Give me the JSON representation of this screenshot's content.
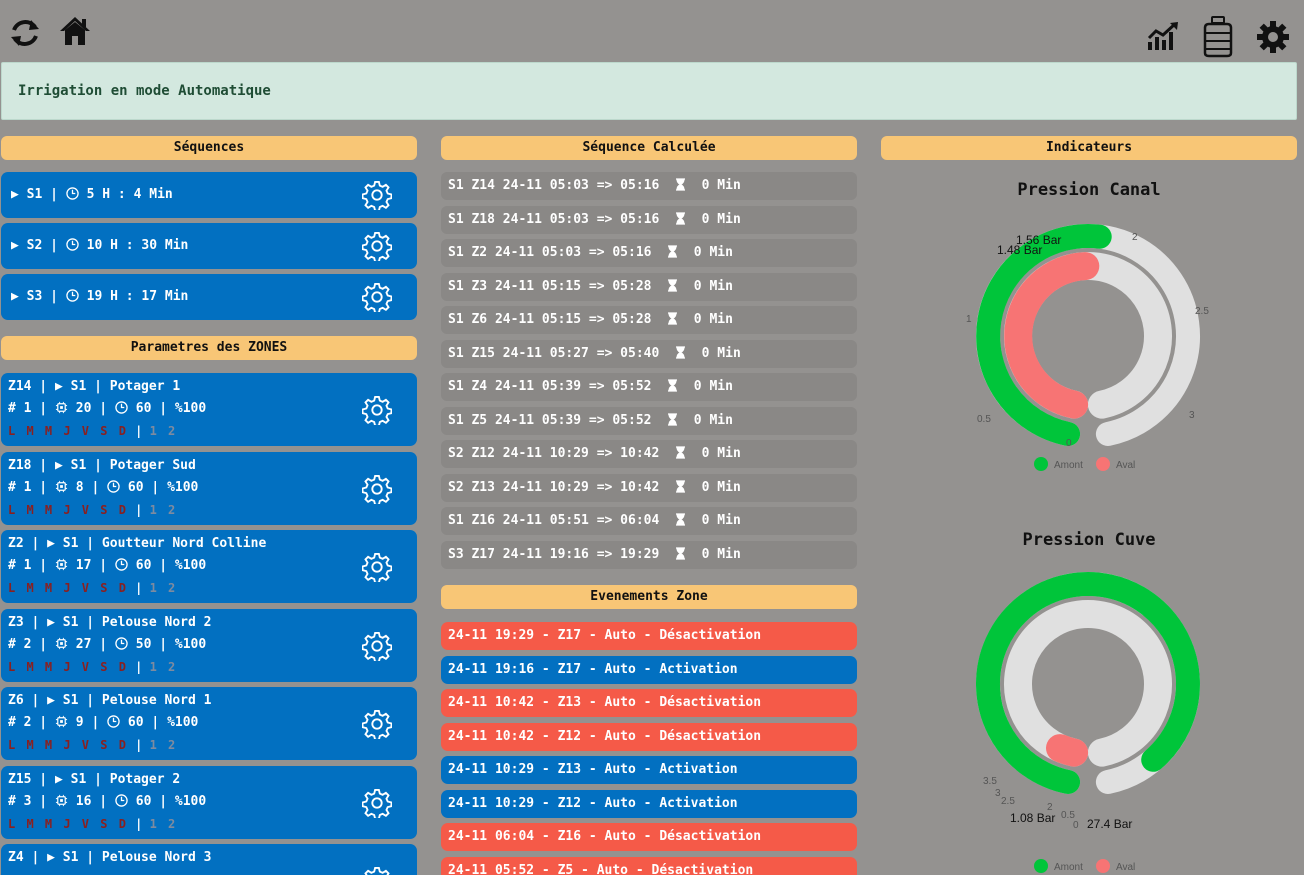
{
  "colors": {
    "blue": "#0270c1",
    "red": "#f55a48",
    "orange": "#f8c676",
    "green": "#00c53a",
    "pink": "#f77474",
    "track": "#e0e0e0"
  },
  "toolbar": {
    "left_icons": [
      "refresh-icon",
      "home-icon"
    ],
    "right_icons": [
      "chart-icon",
      "tank-icon",
      "gear-icon"
    ]
  },
  "banner": {
    "text": "Irrigation en mode Automatique"
  },
  "sequences": {
    "title": "Séquences",
    "items": [
      {
        "id": "S1",
        "duration": "5 H : 4 Min"
      },
      {
        "id": "S2",
        "duration": "10 H : 30 Min"
      },
      {
        "id": "S3",
        "duration": "19 H : 17 Min"
      }
    ]
  },
  "zones": {
    "title": "Parametres des ZONES",
    "days": "L M M J V S D",
    "items": [
      {
        "id": "Z14",
        "seq": "S1",
        "name": "Potager 1",
        "order": "1",
        "flow": "20",
        "time": "60",
        "pct": "100",
        "hours": "1 2"
      },
      {
        "id": "Z18",
        "seq": "S1",
        "name": "Potager Sud",
        "order": "1",
        "flow": "8",
        "time": "60",
        "pct": "100",
        "hours": "1 2"
      },
      {
        "id": "Z2",
        "seq": "S1",
        "name": "Goutteur Nord Colline",
        "order": "1",
        "flow": "17",
        "time": "60",
        "pct": "100",
        "hours": "1 2"
      },
      {
        "id": "Z3",
        "seq": "S1",
        "name": "Pelouse Nord 2",
        "order": "2",
        "flow": "27",
        "time": "50",
        "pct": "100",
        "hours": "1 2"
      },
      {
        "id": "Z6",
        "seq": "S1",
        "name": "Pelouse Nord 1",
        "order": "2",
        "flow": "9",
        "time": "60",
        "pct": "100",
        "hours": "1 2"
      },
      {
        "id": "Z15",
        "seq": "S1",
        "name": "Potager 2",
        "order": "3",
        "flow": "16",
        "time": "60",
        "pct": "100",
        "hours": "1 2"
      },
      {
        "id": "Z4",
        "seq": "S1",
        "name": "Pelouse Nord 3"
      }
    ]
  },
  "calc": {
    "title": "Séquence Calculée",
    "items": [
      {
        "text": "S1 Z14 24-11 05:03 => 05:16",
        "dur": "0 Min"
      },
      {
        "text": "S1 Z18 24-11 05:03 => 05:16",
        "dur": "0 Min"
      },
      {
        "text": "S1 Z2 24-11 05:03 => 05:16",
        "dur": "0 Min"
      },
      {
        "text": "S1 Z3 24-11 05:15 => 05:28",
        "dur": "0 Min"
      },
      {
        "text": "S1 Z6 24-11 05:15 => 05:28",
        "dur": "0 Min"
      },
      {
        "text": "S1 Z15 24-11 05:27 => 05:40",
        "dur": "0 Min"
      },
      {
        "text": "S1 Z4 24-11 05:39 => 05:52",
        "dur": "0 Min"
      },
      {
        "text": "S1 Z5 24-11 05:39 => 05:52",
        "dur": "0 Min"
      },
      {
        "text": "S2 Z12 24-11 10:29 => 10:42",
        "dur": "0 Min"
      },
      {
        "text": "S2 Z13 24-11 10:29 => 10:42",
        "dur": "0 Min"
      },
      {
        "text": "S1 Z16 24-11 05:51 => 06:04",
        "dur": "0 Min"
      },
      {
        "text": "S3 Z17 24-11 19:16 => 19:29",
        "dur": "0 Min"
      }
    ]
  },
  "events": {
    "title": "Evenements Zone",
    "items": [
      {
        "text": "24-11 19:29 - Z17 - Auto - Désactivation",
        "kind": "off"
      },
      {
        "text": "24-11 19:16 - Z17 - Auto - Activation",
        "kind": "on"
      },
      {
        "text": "24-11 10:42 - Z13 - Auto - Désactivation",
        "kind": "off"
      },
      {
        "text": "24-11 10:42 - Z12 - Auto - Désactivation",
        "kind": "off"
      },
      {
        "text": "24-11 10:29 - Z13 - Auto - Activation",
        "kind": "on"
      },
      {
        "text": "24-11 10:29 - Z12 - Auto - Activation",
        "kind": "on"
      },
      {
        "text": "24-11 06:04 - Z16 - Auto - Désactivation",
        "kind": "off"
      },
      {
        "text": "24-11 05:52 - Z5 - Auto - Désactivation",
        "kind": "off"
      }
    ]
  },
  "indicators": {
    "title": "Indicateurs"
  },
  "chart_data": [
    {
      "type": "gauge",
      "title": "Pression Canal",
      "min": 0,
      "max": 3,
      "ticks": [
        "0",
        "0.5",
        "1",
        "2",
        "2.5",
        "3"
      ],
      "series": [
        {
          "name": "Amont",
          "value": 1.56,
          "label": "1.56 Bar"
        },
        {
          "name": "Aval",
          "value": 1.48,
          "label": "1.48 Bar"
        }
      ],
      "legend": "bottom"
    },
    {
      "type": "gauge",
      "title": "Pression Cuve",
      "min": 0,
      "max": 30,
      "ticks": [
        "0",
        "0.5",
        "2",
        "2.5",
        "3",
        "3.5"
      ],
      "series": [
        {
          "name": "Amont",
          "value": 27.4,
          "label": "27.4 Bar"
        },
        {
          "name": "Aval",
          "value": 1.08,
          "label": "1.08 Bar"
        }
      ],
      "legend": "bottom"
    }
  ]
}
